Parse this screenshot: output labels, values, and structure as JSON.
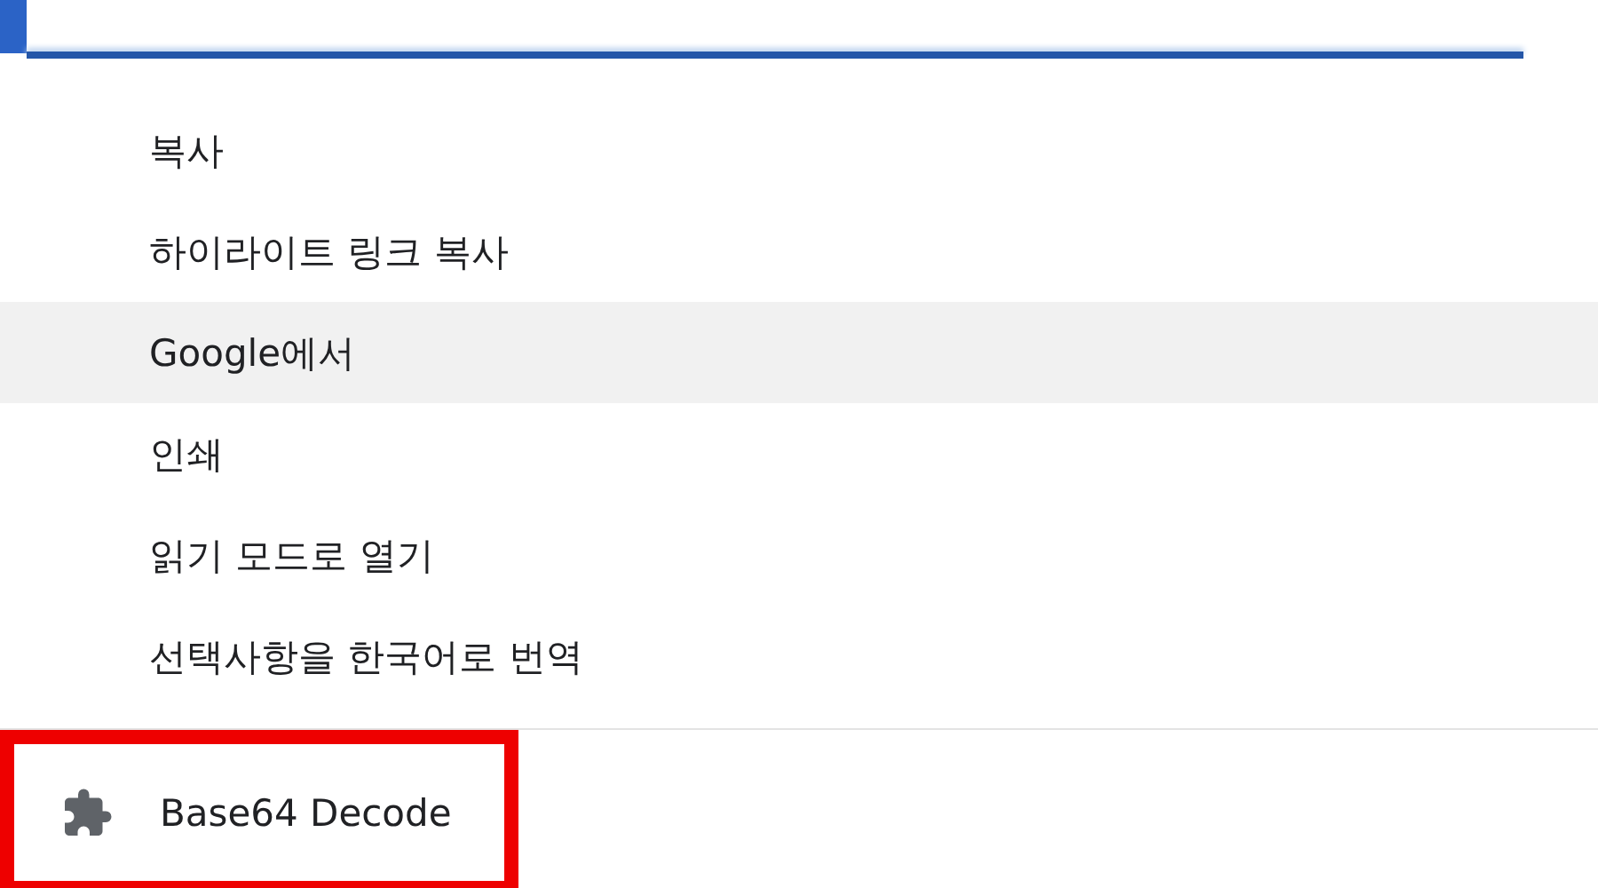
{
  "menu_items": [
    {
      "label": "복사",
      "selected": false
    },
    {
      "label": "하이라이트 링크 복사",
      "selected": false
    },
    {
      "label": "Google에서",
      "selected": true
    },
    {
      "label": "인쇄",
      "selected": false
    },
    {
      "label": "읽기 모드로 열기",
      "selected": false
    },
    {
      "label": "선택사항을 한국어로 번역",
      "selected": false
    }
  ],
  "extensions": [
    {
      "label": "Base64 Decode",
      "highlighted": true
    }
  ]
}
